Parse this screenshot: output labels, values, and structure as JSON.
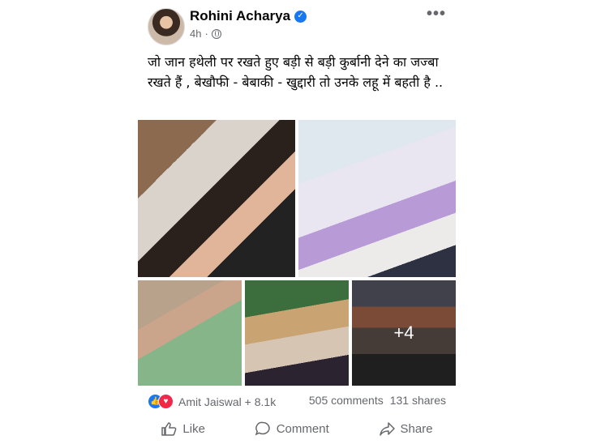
{
  "post": {
    "author": "Rohini Acharya",
    "verified_icon": "verified-badge-icon",
    "time": "4h",
    "separator": "·",
    "privacy_icon": "globe-icon",
    "more_label": "•••",
    "caption": "जो जान हथेली पर रखते हुए बड़ी से बड़ी कुर्बानी देने का जज्बा रखते हैं , बेखौफी - बेबाकी - खुद्दारी तो उनके लहू में बहती है ..",
    "more_photos": "+4"
  },
  "engagement": {
    "reaction_icons": [
      "like-icon",
      "love-icon"
    ],
    "reactions_text": "Amit Jaiswal + 8.1k",
    "comments": "505 comments",
    "shares": "131 shares"
  },
  "actions": {
    "like": "Like",
    "comment": "Comment",
    "share": "Share"
  },
  "colors": {
    "accent": "#1877f2",
    "love": "#f0284a",
    "secondary_text": "#65676b"
  }
}
